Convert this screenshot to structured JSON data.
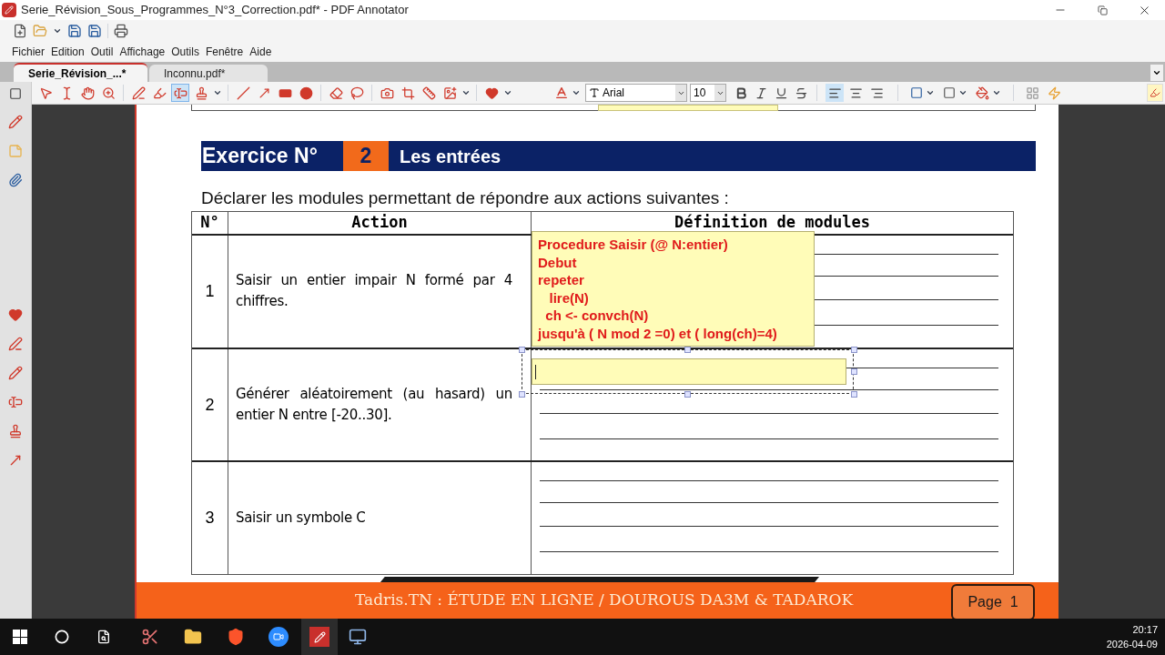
{
  "window": {
    "title": "Serie_Révision_Sous_Programmes_N°3_Correction.pdf* - PDF Annotator"
  },
  "menu": [
    "Fichier",
    "Edition",
    "Outil",
    "Affichage",
    "Outils",
    "Fenêtre",
    "Aide"
  ],
  "tabs": [
    {
      "label": "Serie_Révision_...*",
      "selected": true
    },
    {
      "label": "Inconnu.pdf*",
      "selected": false
    }
  ],
  "tool_groups": [
    [
      {
        "kind": "pointer",
        "selected": false
      },
      {
        "kind": "text-select",
        "selected": false
      },
      {
        "kind": "hand",
        "selected": false
      },
      {
        "kind": "zoom",
        "selected": false
      }
    ],
    [
      {
        "kind": "pen",
        "selected": false
      },
      {
        "kind": "highlighter",
        "selected": false
      },
      {
        "kind": "textbox",
        "selected": true
      },
      {
        "kind": "stamp",
        "selected": false
      }
    ],
    [
      {
        "kind": "line",
        "selected": false
      },
      {
        "kind": "arrow",
        "selected": false
      },
      {
        "kind": "rectangle",
        "selected": false
      },
      {
        "kind": "ellipse",
        "selected": false
      }
    ],
    [
      {
        "kind": "eraser",
        "selected": false
      },
      {
        "kind": "lasso",
        "selected": false
      }
    ],
    [
      {
        "kind": "camera",
        "selected": false
      },
      {
        "kind": "crop",
        "selected": false
      },
      {
        "kind": "ruler",
        "selected": false
      },
      {
        "kind": "image",
        "selected": false
      }
    ],
    [
      {
        "kind": "heart",
        "selected": false
      }
    ]
  ],
  "font": {
    "name": "Arial",
    "size": "10"
  },
  "alignment": [
    {
      "selected": true
    },
    {
      "selected": false
    },
    {
      "selected": false
    }
  ],
  "document": {
    "exercise_label": "Exercice N°",
    "exercise_number": "2",
    "exercise_title": "Les entrées",
    "instruction": "Déclarer les modules permettant de répondre aux actions suivantes :",
    "table": {
      "columns": [
        "N°",
        "Action",
        "Définition de modules"
      ],
      "rows": [
        {
          "number": "1",
          "action": "Saisir un entier impair N formé par 4 chiffres."
        },
        {
          "number": "2",
          "action": "Générer aléatoirement (au hasard) un entier N entre [-20..30]."
        },
        {
          "number": "3",
          "action": "Saisir un symbole C"
        }
      ]
    },
    "annotation": "Procedure Saisir (@ N:entier)\nDebut\nrepeter\n   lire(N)\n  ch <- convch(N)\njusqu'à ( N mod 2 =0) et ( long(ch)=4)",
    "footer": "Tadris.TN : ÉTUDE EN LIGNE / DOUROUS DA3M & TADAROK",
    "page_label": "Page  1"
  },
  "taskbar": {
    "time": "20:17",
    "date": "2026-04-09"
  }
}
